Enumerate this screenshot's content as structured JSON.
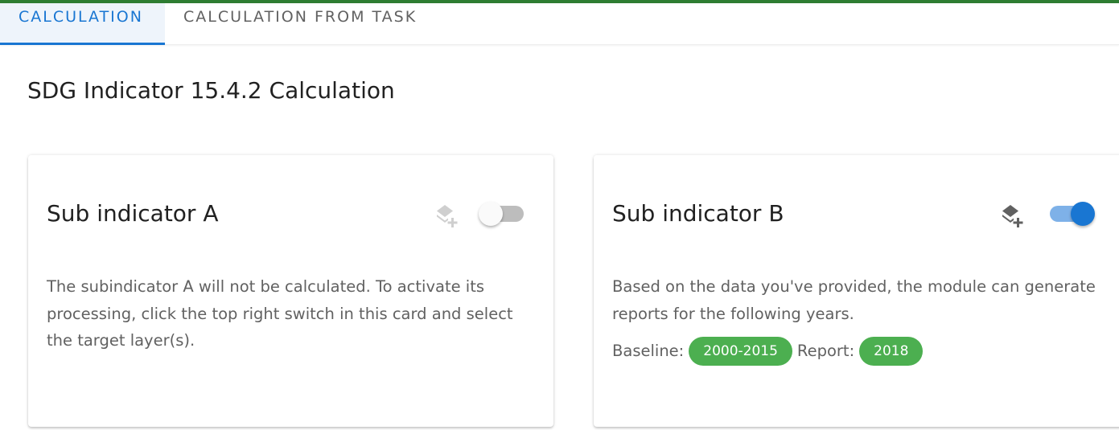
{
  "tabs": [
    {
      "label": "CALCULATION",
      "active": true
    },
    {
      "label": "CALCULATION FROM TASK",
      "active": false
    }
  ],
  "page": {
    "title": "SDG Indicator 15.4.2 Calculation"
  },
  "cards": [
    {
      "title": "Sub indicator A",
      "icon": "layers-plus-icon",
      "switch_on": false,
      "text": "The subindicator A will not be calculated. To activate its processing, click the top right switch in this card and select the target layer(s)."
    },
    {
      "title": "Sub indicator B",
      "icon": "layers-plus-icon",
      "switch_on": true,
      "text": "Based on the data you've provided, the module can generate reports for the following years.",
      "baseline_label": "Baseline:",
      "baseline_value": "2000-2015",
      "report_label": "Report:",
      "report_value": "2018"
    }
  ],
  "colors": {
    "accent": "#1976d2",
    "top_bar": "#2e7d32",
    "chip": "#4caf50",
    "switch_track_on": "#7eb1e8",
    "switch_track_off": "#bdbdbd"
  }
}
